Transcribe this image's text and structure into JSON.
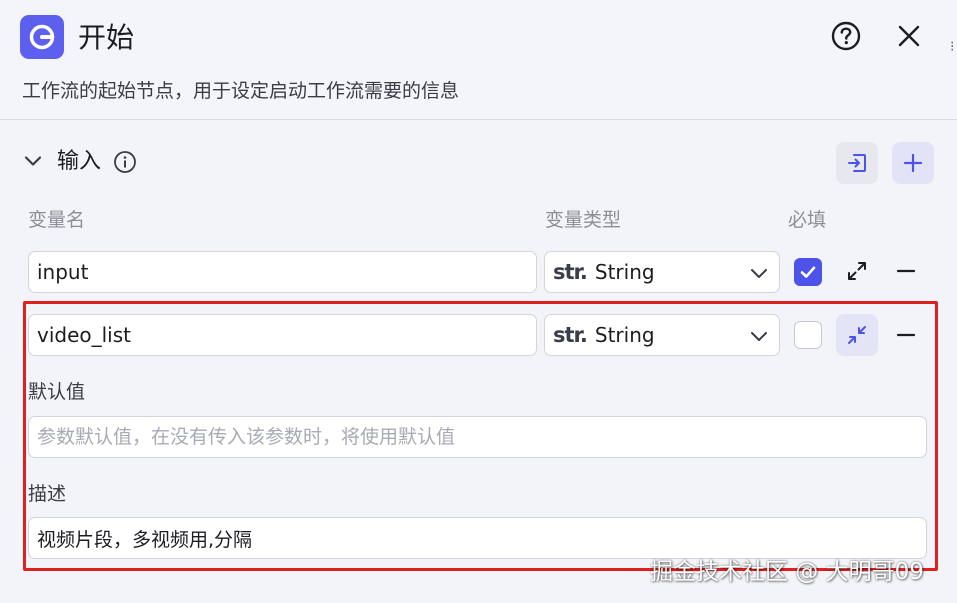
{
  "header": {
    "title": "开始",
    "subtitle": "工作流的起始节点，用于设定启动工作流需要的信息",
    "brand_color": "#5d5fef"
  },
  "section": {
    "title": "输入"
  },
  "columns": {
    "name": "变量名",
    "type": "变量类型",
    "required": "必填"
  },
  "rows": [
    {
      "name": "input",
      "type_prefix": "str.",
      "type_value": "String",
      "required": true,
      "expanded": false
    },
    {
      "name": "video_list",
      "type_prefix": "str.",
      "type_value": "String",
      "required": false,
      "expanded": true,
      "default_label": "默认值",
      "default_placeholder": "参数默认值，在没有传入该参数时，将使用默认值",
      "desc_label": "描述",
      "desc_value": "视频片段，多视频用,分隔"
    }
  ],
  "colors": {
    "accent": "#4d53e8",
    "highlight": "#e0201f"
  },
  "watermark": "掘金技术社区 @ 大明哥09"
}
